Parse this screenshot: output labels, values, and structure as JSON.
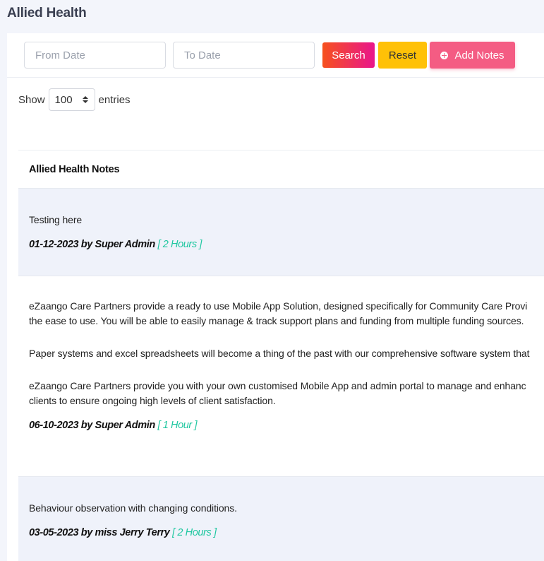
{
  "page": {
    "title": "Allied Health"
  },
  "filters": {
    "from_placeholder": "From Date",
    "to_placeholder": "To Date",
    "search_label": "Search",
    "reset_label": "Reset",
    "add_label": "Add Notes",
    "add_icon": "plus-circle-icon"
  },
  "entries": {
    "show_label": "Show",
    "selected": "100",
    "suffix_label": "entries"
  },
  "table": {
    "header": "Allied Health Notes",
    "rows": [
      {
        "paragraphs": [
          "Testing here"
        ],
        "meta": "01-12-2023 by Super Admin",
        "duration": "[ 2 Hours ]"
      },
      {
        "paragraphs": [
          "eZaango Care Partners provide a ready to use Mobile App Solution, designed specifically for Community Care Provi",
          "the ease to use. You will be able to easily manage & track support plans and funding from multiple funding sources.",
          "Paper systems and excel spreadsheets will become a thing of the past with our comprehensive software system that",
          "eZaango Care Partners provide you with your own customised Mobile App and admin portal to manage and enhanc",
          "clients to ensure ongoing high levels of client satisfaction."
        ],
        "meta": "06-10-2023 by Super Admin",
        "duration": "[ 1 Hour ]"
      },
      {
        "paragraphs": [
          "Behaviour observation with changing conditions."
        ],
        "meta": "03-05-2023 by miss Jerry Terry",
        "duration": "[ 2 Hours ]"
      }
    ]
  },
  "colors": {
    "duration_accent": "#1fc7a0",
    "search_gradient_start": "#f6511d",
    "search_gradient_end": "#e9168c",
    "reset_bg": "#ffc107",
    "add_bg": "#f45c83",
    "alt_row_bg": "#eff2fa"
  }
}
